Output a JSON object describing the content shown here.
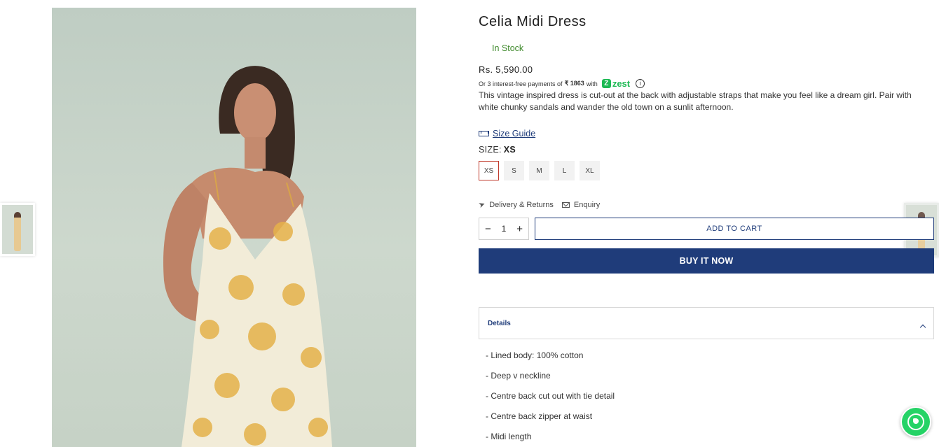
{
  "product": {
    "title": "Celia Midi Dress",
    "stock": "In Stock",
    "price": "Rs. 5,590.00",
    "emi": {
      "prefix": "Or 3 interest-free payments of",
      "amount": "₹ 1863",
      "with": "with",
      "brand": "zest",
      "brand_color": "#1db954",
      "info_glyph": "i"
    },
    "description": "This vintage inspired dress is cut-out at the back with adjustable straps that make you feel like a dream girl. Pair with white chunky sandals and wander the old town on a sunlit afternoon."
  },
  "size_guide": {
    "label": "Size Guide",
    "icon": "ruler-icon"
  },
  "size": {
    "label": "SIZE:",
    "selected": "XS",
    "options": [
      "XS",
      "S",
      "M",
      "L",
      "XL"
    ]
  },
  "links": {
    "delivery": "Delivery & Returns",
    "enquiry": "Enquiry"
  },
  "cart": {
    "qty_minus": "−",
    "qty_value": "1",
    "qty_plus": "+",
    "add_to_cart": "ADD TO CART",
    "buy_now": "BUY IT NOW"
  },
  "details": {
    "heading": "Details",
    "items": [
      "- Lined body: 100% cotton",
      "- Deep v neckline",
      "- Centre back cut out with tie detail",
      "- Centre back zipper at waist",
      "- Midi length"
    ]
  },
  "colors": {
    "accent": "#1f3c7a",
    "in_stock": "#3f8a2c",
    "selected_size_border": "#c0392b",
    "whatsapp": "#25d366"
  }
}
